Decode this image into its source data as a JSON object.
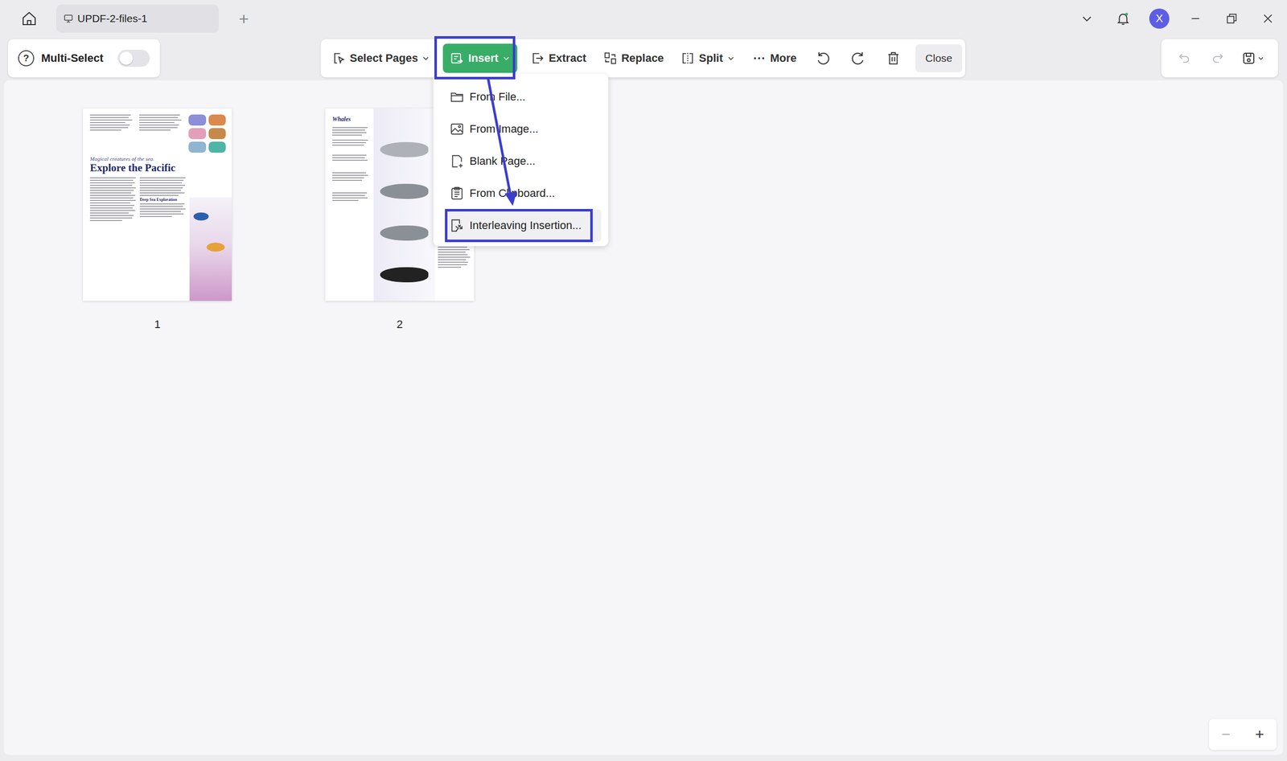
{
  "window": {
    "tab_title": "UPDF-2-files-1",
    "new_tab": "+"
  },
  "user": {
    "initial": "X"
  },
  "multi_select": {
    "help": "?",
    "label": "Multi-Select",
    "on": false
  },
  "toolbar": {
    "items": [
      {
        "label": "Select Pages",
        "kind": "dropdown",
        "selected": false,
        "highlighted": false
      },
      {
        "label": "Insert",
        "kind": "dropdown",
        "selected": true,
        "highlighted": true
      },
      {
        "label": "Extract",
        "kind": "button",
        "selected": false,
        "highlighted": false
      },
      {
        "label": "Replace",
        "kind": "button",
        "selected": false,
        "highlighted": false
      },
      {
        "label": "Split",
        "kind": "dropdown",
        "selected": false,
        "highlighted": false
      },
      {
        "label": "More",
        "kind": "button",
        "selected": false,
        "highlighted": false
      }
    ],
    "close": "Close"
  },
  "insert_menu": {
    "open": true,
    "items": [
      {
        "label": "From File...",
        "highlighted": false,
        "hovered": false
      },
      {
        "label": "From Image...",
        "highlighted": false,
        "hovered": false
      },
      {
        "label": "Blank Page...",
        "highlighted": false,
        "hovered": false
      },
      {
        "label": "From Clipboard...",
        "highlighted": false,
        "hovered": false
      },
      {
        "label": "Interleaving Insertion...",
        "highlighted": true,
        "hovered": true
      }
    ]
  },
  "pages": [
    {
      "number": "1",
      "kind": "article",
      "subtitle": "Magical creatures of the sea.",
      "title": "Explore the Pacific",
      "section": "Deep Sea Exploration"
    },
    {
      "number": "2",
      "kind": "whales",
      "title": "Whales"
    }
  ],
  "zoom": {
    "out": "−",
    "in": "+"
  }
}
